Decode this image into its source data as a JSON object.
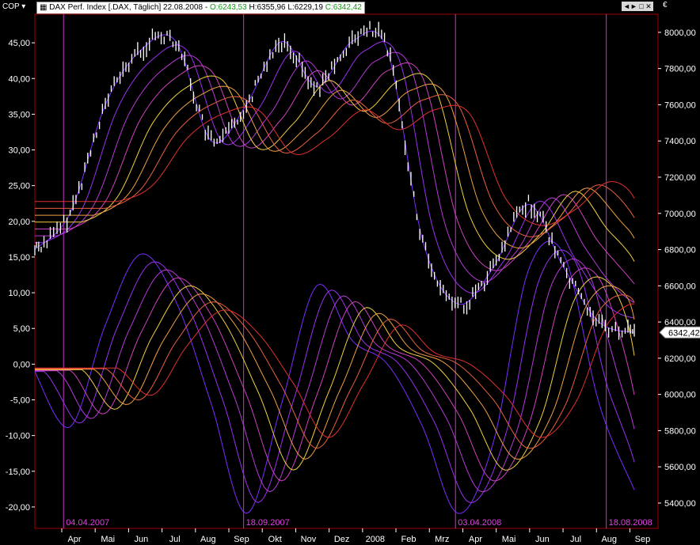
{
  "header": {
    "ticker_label": "COP",
    "instrument": "DAX Perf. Index [.DAX, Täglich]",
    "date": "22.08.2008",
    "open": "O:6243,53",
    "high": "H:6355,96",
    "low": "L:6229,19",
    "close": "C:6342,42",
    "currency": "€",
    "window_buttons": "◄► □ ✕"
  },
  "colors": {
    "background": "#000000",
    "price_bars": "#ffffff",
    "vertical_markers": "#cc33cc",
    "marker_labels": "#dd44dd",
    "axis": "#ffffff",
    "open_value": "#33dd33",
    "close_value": "#33dd33",
    "ribbon_gradient": [
      "#7a2cff",
      "#9a30f0",
      "#b838d8",
      "#d040c0",
      "#f0d040",
      "#f0a040",
      "#e86040",
      "#e03030"
    ]
  },
  "chart_data": {
    "type": "line",
    "left_axis": {
      "ticks": [
        "45,00",
        "40,00",
        "35,00",
        "30,00",
        "25,00",
        "20,00",
        "15,00",
        "10,00",
        "5,00",
        "0,00",
        "-5,00",
        "-10,00",
        "-15,00",
        "-20,00"
      ],
      "range": [
        -23,
        49
      ]
    },
    "right_axis": {
      "ticks": [
        "8000,00",
        "7800,00",
        "7600,00",
        "7400,00",
        "7200,00",
        "7000,00",
        "6800,00",
        "6600,00",
        "6400,00",
        "6200,00",
        "6000,00",
        "5800,00",
        "5600,00",
        "5400,00"
      ],
      "range": [
        5260,
        8100
      ]
    },
    "x_ticks": [
      "Apr",
      "Mai",
      "Jun",
      "Jul",
      "Aug",
      "Sep",
      "Okt",
      "Nov",
      "Dez",
      "2008",
      "Feb",
      "Mrz",
      "Apr",
      "Mai",
      "Jun",
      "Jul",
      "Aug",
      "Sep"
    ],
    "last_price_label": "6342,42",
    "markers": [
      "04.04.2007",
      "18.09.2007",
      "03.04.2008",
      "18.08.2008"
    ],
    "price_series": [
      {
        "d": "Mrz",
        "v": 6800
      },
      {
        "d": "Apr",
        "v": 7000
      },
      {
        "d": "Mai",
        "v": 7600
      },
      {
        "d": "Jun",
        "v": 7900
      },
      {
        "d": "Jul",
        "v": 7950
      },
      {
        "d": "Aug",
        "v": 7400
      },
      {
        "d": "Sep",
        "v": 7600
      },
      {
        "d": "Okt",
        "v": 7950
      },
      {
        "d": "Nov",
        "v": 7700
      },
      {
        "d": "Dez",
        "v": 7950
      },
      {
        "d": "2008",
        "v": 7900
      },
      {
        "d": "Feb",
        "v": 6850
      },
      {
        "d": "Mrz",
        "v": 6500
      },
      {
        "d": "Apr",
        "v": 6700
      },
      {
        "d": "Mai",
        "v": 7050
      },
      {
        "d": "Jun",
        "v": 6700
      },
      {
        "d": "Jul",
        "v": 6400
      },
      {
        "d": "Aug",
        "v": 6342
      }
    ],
    "ribbon_series": [
      {
        "d": "Mrz",
        "v": -1
      },
      {
        "d": "Apr",
        "v": -8
      },
      {
        "d": "Mai",
        "v": 5
      },
      {
        "d": "Jun",
        "v": 14
      },
      {
        "d": "Jul",
        "v": 8
      },
      {
        "d": "Aug",
        "v": -5
      },
      {
        "d": "Sep",
        "v": -19
      },
      {
        "d": "Okt",
        "v": -5
      },
      {
        "d": "Nov",
        "v": 10
      },
      {
        "d": "Dez",
        "v": 3
      },
      {
        "d": "2008",
        "v": 0
      },
      {
        "d": "Feb",
        "v": -8
      },
      {
        "d": "Mrz",
        "v": -19
      },
      {
        "d": "Apr",
        "v": -10
      },
      {
        "d": "Mai",
        "v": 12
      },
      {
        "d": "Jun",
        "v": 14
      },
      {
        "d": "Jul",
        "v": -5
      },
      {
        "d": "Aug",
        "v": -16
      }
    ]
  }
}
